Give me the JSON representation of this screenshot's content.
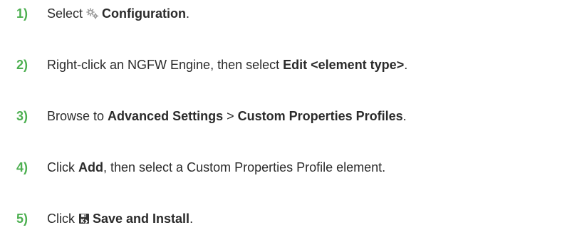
{
  "accent": "#4caf50",
  "icons": {
    "configuration": "gears-icon",
    "save_install": "save-install-icon"
  },
  "steps": [
    {
      "num": "1)",
      "a": "Select",
      "b": "Configuration",
      "c": "."
    },
    {
      "num": "2)",
      "a": "Right-click an NGFW Engine, then select ",
      "b": "Edit <element type>",
      "c": "."
    },
    {
      "num": "3)",
      "a": "Browse to ",
      "b": "Advanced Settings",
      "sep": " > ",
      "d": "Custom Properties Profiles",
      "c": "."
    },
    {
      "num": "4)",
      "a": "Click ",
      "b": "Add",
      "c": ", then select a Custom Properties Profile element."
    },
    {
      "num": "5)",
      "a": "Click",
      "b": "Save and Install",
      "c": "."
    }
  ]
}
